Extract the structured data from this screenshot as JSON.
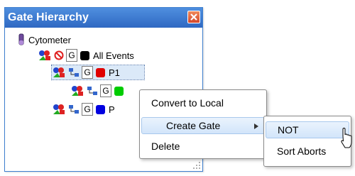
{
  "window": {
    "title": "Gate Hierarchy"
  },
  "tree": {
    "root": {
      "label": "Cytometer"
    },
    "nodes": [
      {
        "gate_button": "G",
        "label": "All Events",
        "color": "#000000"
      },
      {
        "gate_button": "G",
        "label": "P1",
        "color": "#e00000"
      },
      {
        "gate_button": "G",
        "label": "",
        "color": "#00cc00"
      },
      {
        "gate_button": "G",
        "label": "P",
        "color": "#0000e0"
      }
    ]
  },
  "context_menu": {
    "items": [
      {
        "label": "Convert to Local"
      },
      {
        "label": "Create Gate",
        "has_submenu": true
      },
      {
        "label": "Delete"
      }
    ]
  },
  "submenu": {
    "items": [
      {
        "label": "NOT"
      },
      {
        "label": "Sort Aborts"
      }
    ]
  },
  "colors": {
    "title_bar": "#3a78d0",
    "highlight": "#d2e5fa"
  }
}
